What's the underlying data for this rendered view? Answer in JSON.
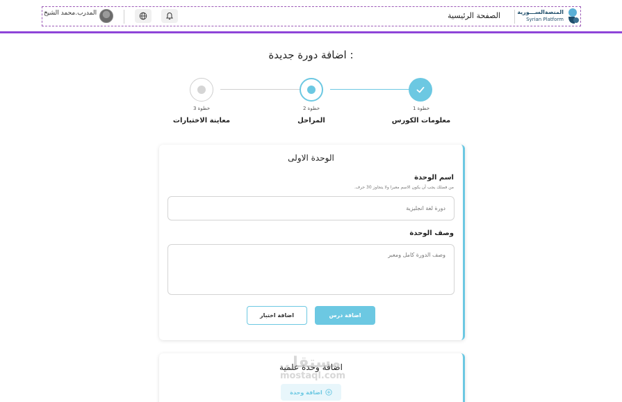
{
  "header": {
    "logo_ar": "المنصةالســـورية",
    "logo_en": "Syrian Platform",
    "home_link": "الصفحة الرئيسية",
    "trainer_name": "المدرب.محمد الشيخ",
    "accent_color": "#8e44d8"
  },
  "page": {
    "title": "اضافة دورة جديدة :"
  },
  "stepper": {
    "steps": [
      {
        "sub": "خطوة 1",
        "label": "معلومات الكورس",
        "state": "completed"
      },
      {
        "sub": "خطوة 2",
        "label": "المراحل",
        "state": "active"
      },
      {
        "sub": "خطوة 3",
        "label": "معاينة الاختبارات",
        "state": "pending"
      }
    ],
    "accent_color": "#6cc8e2"
  },
  "unit_card": {
    "title": "الوحدة الاولى",
    "name_label": "اسم الوحدة",
    "name_hint": "من فضلك يجب أن يكون الاسم معبرا ولا يتجاوز 30 حرف.",
    "name_placeholder": "دورة لغة انجليزية",
    "description_label": "وصف الوحدة",
    "description_placeholder": "وصف الدورة كامل ومعبر",
    "add_lesson_button": "اضافة درس",
    "add_quiz_button": "اضافة اختبار"
  },
  "add_unit_card": {
    "title": "اضافة وحدة علمية",
    "add_unit_button": "اضافة وحدة"
  },
  "watermark": {
    "ar": "مستقل",
    "en": "mostaql.com"
  }
}
